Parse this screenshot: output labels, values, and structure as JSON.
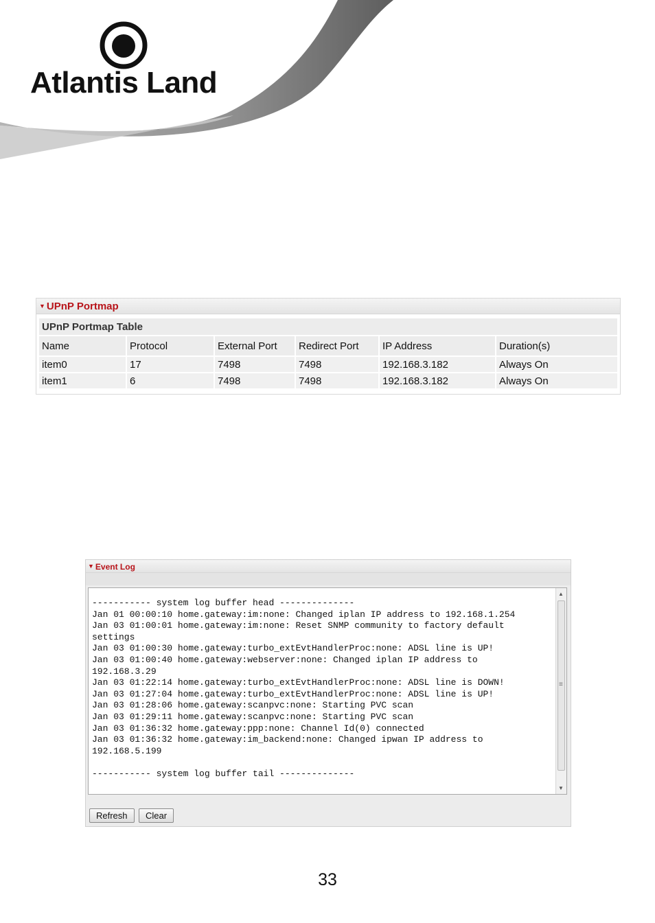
{
  "brand": {
    "name": "Atlantis Land"
  },
  "upnp": {
    "panel_title": "UPnP Portmap",
    "table_title": "UPnP Portmap Table",
    "columns": [
      "Name",
      "Protocol",
      "External Port",
      "Redirect Port",
      "IP Address",
      "Duration(s)"
    ],
    "rows": [
      [
        "item0",
        "17",
        "7498",
        "7498",
        "192.168.3.182",
        "Always On"
      ],
      [
        "item1",
        "6",
        "7498",
        "7498",
        "192.168.3.182",
        "Always On"
      ]
    ]
  },
  "event_log": {
    "panel_title": "Event Log",
    "lines": [
      "----------- system log buffer head --------------",
      "Jan 01 00:00:10 home.gateway:im:none: Changed iplan IP address to 192.168.1.254",
      "Jan 03 01:00:01 home.gateway:im:none: Reset SNMP community to factory default",
      "settings",
      "Jan 03 01:00:30 home.gateway:turbo_extEvtHandlerProc:none: ADSL line is UP!",
      "Jan 03 01:00:40 home.gateway:webserver:none: Changed iplan IP address to",
      "192.168.3.29",
      "Jan 03 01:22:14 home.gateway:turbo_extEvtHandlerProc:none: ADSL line is DOWN!",
      "Jan 03 01:27:04 home.gateway:turbo_extEvtHandlerProc:none: ADSL line is UP!",
      "Jan 03 01:28:06 home.gateway:scanpvc:none: Starting PVC scan",
      "Jan 03 01:29:11 home.gateway:scanpvc:none: Starting PVC scan",
      "Jan 03 01:36:32 home.gateway:ppp:none: Channel Id(0) connected",
      "Jan 03 01:36:32 home.gateway:im_backend:none: Changed ipwan IP address to",
      "192.168.5.199",
      "",
      "----------- system log buffer tail --------------"
    ],
    "refresh_label": "Refresh",
    "clear_label": "Clear"
  },
  "page_number": "33"
}
